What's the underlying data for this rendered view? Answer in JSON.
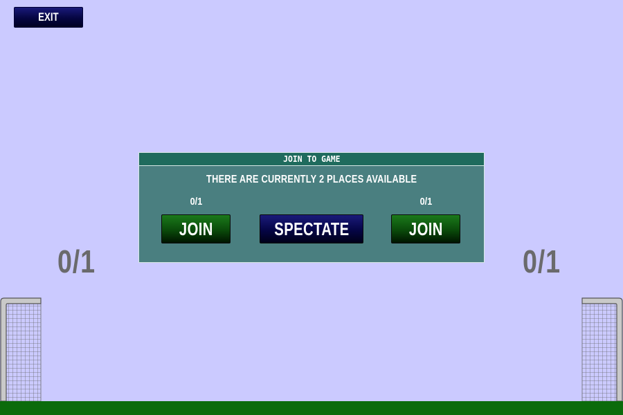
{
  "toolbar": {
    "exit_label": "EXIT"
  },
  "scoreboard": {
    "left_score": "0/1",
    "right_score": "0/1"
  },
  "join_dialog": {
    "title": "JOIN TO GAME",
    "message": "THERE ARE CURRENTLY 2 PLACES AVAILABLE",
    "left_slot_count": "0/1",
    "right_slot_count": "0/1",
    "left_join_label": "JOIN",
    "spectate_label": "SPECTATE",
    "right_join_label": "JOIN"
  },
  "colors": {
    "sky": "#cbcaff",
    "dialog_body": "#4a7f80",
    "dialog_title": "#1f6b5d",
    "join_button": "#0a4a0a",
    "spectate_button": "#050545",
    "ground": "#0b6b0b",
    "score_text": "#6a6a6c"
  }
}
